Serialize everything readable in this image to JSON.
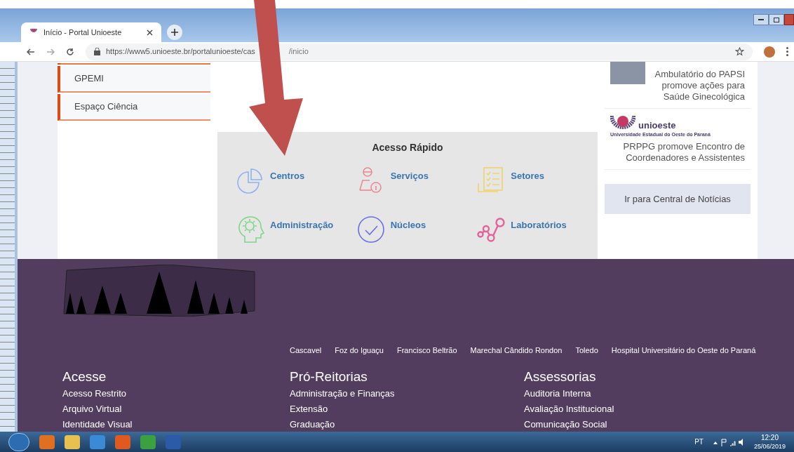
{
  "browser": {
    "tab_title": "Início - Portal Unioeste",
    "url_start": "https://www5.unioeste.br/portalunioeste/cas",
    "url_end": "/inicio"
  },
  "sidebar": {
    "items": [
      "GPEMI",
      "Espaço Ciência"
    ]
  },
  "quick_access": {
    "title": "Acesso Rápido",
    "items": [
      {
        "label": "Centros",
        "kind": "pie"
      },
      {
        "label": "Serviços",
        "kind": "person-info"
      },
      {
        "label": "Setores",
        "kind": "checklist"
      },
      {
        "label": "Administração",
        "kind": "head-gear"
      },
      {
        "label": "Núcleos",
        "kind": "check-circle"
      },
      {
        "label": "Laboratórios",
        "kind": "nodes"
      }
    ]
  },
  "news": {
    "items": [
      {
        "kind": "photo",
        "text": "Ambulatório do PAPSI promove ações para Saúde Ginecológica"
      },
      {
        "kind": "logo",
        "logo_text": "unioeste",
        "logo_subtitle": "Universidade Estadual do Oeste do Paraná",
        "text": "PRPPG promove Encontro de Coordenadores e Assistentes"
      }
    ],
    "button": "Ir para Central de Notícias"
  },
  "footer": {
    "campuses": [
      "Cascavel",
      "Foz do Iguaçu",
      "Francisco Beltrão",
      "Marechal Cândido Rondon",
      "Toledo",
      "Hospital Universitário do Oeste do Paraná"
    ],
    "columns": [
      {
        "heading": "Acesse",
        "links": [
          "Acesso Restrito",
          "Arquivo Virtual",
          "Identidade Visual"
        ]
      },
      {
        "heading": "Pró-Reitorias",
        "links": [
          "Administração e Finanças",
          "Extensão",
          "Graduação"
        ]
      },
      {
        "heading": "Assessorias",
        "links": [
          "Auditoria Interna",
          "Avaliação Institucional",
          "Comunicação Social"
        ]
      }
    ]
  },
  "taskbar": {
    "language": "PT",
    "time": "12:20",
    "date": "25/06/2019"
  }
}
